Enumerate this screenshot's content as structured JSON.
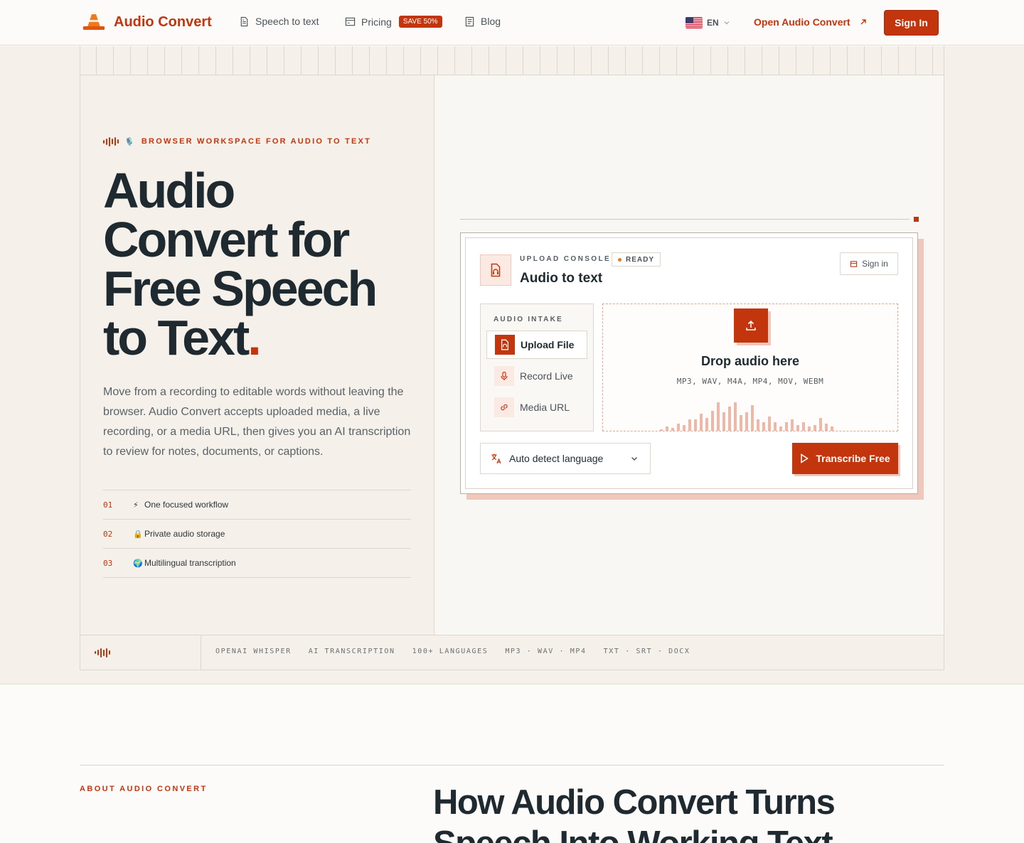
{
  "nav": {
    "brand": "Audio Convert",
    "links": [
      {
        "label": "Speech to text",
        "icon": "document-icon"
      },
      {
        "label": "Pricing",
        "icon": "card-icon",
        "badge": "SAVE 50%"
      },
      {
        "label": "Blog",
        "icon": "blog-icon"
      }
    ],
    "lang": "EN",
    "open_app": "Open Audio Convert",
    "sign_in": "Sign In"
  },
  "hero": {
    "kicker": "BROWSER WORKSPACE FOR AUDIO TO TEXT",
    "title_lines": [
      "Audio",
      "Convert for",
      "Free Speech",
      "to Text"
    ],
    "title_dot": ".",
    "lede": "Move from a recording to editable words without leaving the browser. Audio Convert accepts uploaded media, a live recording, or a media URL, then gives you an AI transcription to review for notes, documents, or captions.",
    "features": [
      {
        "num": "01",
        "emoji": "⚡",
        "label": "One focused workflow"
      },
      {
        "num": "02",
        "emoji": "🔒",
        "label": "Private audio storage"
      },
      {
        "num": "03",
        "emoji": "🌍",
        "label": "Multilingual transcription"
      }
    ],
    "strip": [
      "OPENAI WHISPER",
      "AI TRANSCRIPTION",
      "100+ LANGUAGES",
      "MP3 · WAV · MP4",
      "TXT · SRT · DOCX"
    ]
  },
  "console": {
    "kicker": "UPLOAD CONSOLE",
    "status": "READY",
    "title": "Audio to text",
    "sign_in": "Sign in",
    "intake_label": "AUDIO INTAKE",
    "intake": [
      {
        "label": "Upload File",
        "icon": "file-audio-icon",
        "active": true
      },
      {
        "label": "Record Live",
        "icon": "microphone-icon",
        "active": false
      },
      {
        "label": "Media URL",
        "icon": "link-icon",
        "active": false
      }
    ],
    "drop_title": "Drop audio here",
    "drop_formats": "MP3, WAV, M4A, MP4, MOV, WEBM",
    "language": "Auto detect language",
    "transcribe": "Transcribe Free"
  },
  "about": {
    "kicker": "ABOUT AUDIO CONVERT",
    "title": "How Audio Convert Turns Speech Into Working Text"
  },
  "colors": {
    "accent": "#c2350d",
    "accent_soft": "#efc8bb",
    "hero_bg": "#f5f1ea"
  }
}
